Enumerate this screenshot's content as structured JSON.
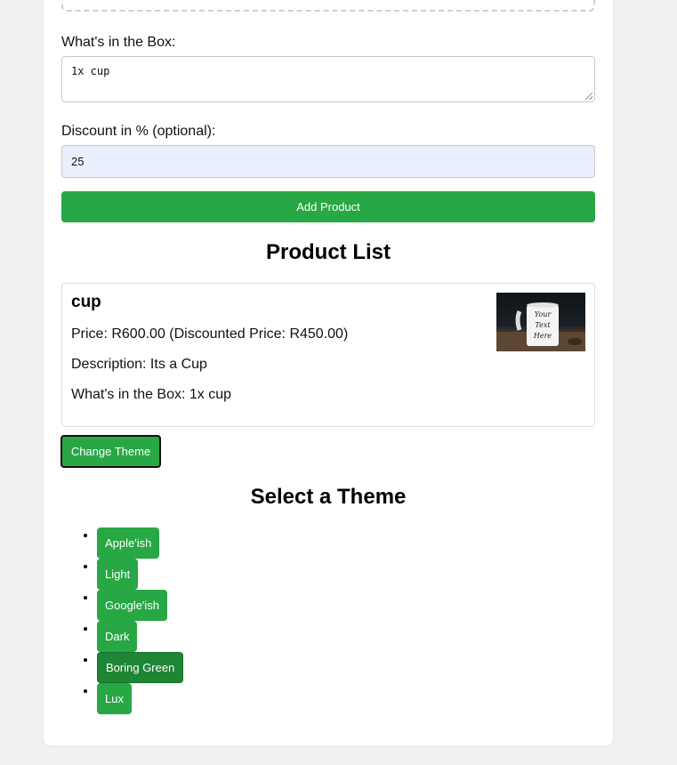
{
  "form": {
    "box_label": "What's in the Box:",
    "box_value": "1x cup",
    "discount_label": "Discount in % (optional):",
    "discount_value": "25",
    "add_button": "Add Product"
  },
  "product_list": {
    "title": "Product List",
    "items": [
      {
        "name": "cup",
        "price_line": "Price: R600.00 (Discounted Price: R450.00)",
        "description_line": "Description: Its a Cup",
        "box_line": "What's in the Box: 1x cup",
        "image_text": [
          "Your",
          "Text",
          "Here"
        ]
      }
    ]
  },
  "theme": {
    "change_button": "Change Theme",
    "title": "Select a Theme",
    "options": [
      "Apple'ish",
      "Light",
      "Google'ish",
      "Dark",
      "Boring Green",
      "Lux"
    ],
    "active": "Boring Green"
  },
  "colors": {
    "accent": "#28a745",
    "accent_active": "#1e8535",
    "input_autofill_bg": "#e8f0fe",
    "page_bg": "#f1f1f1"
  }
}
